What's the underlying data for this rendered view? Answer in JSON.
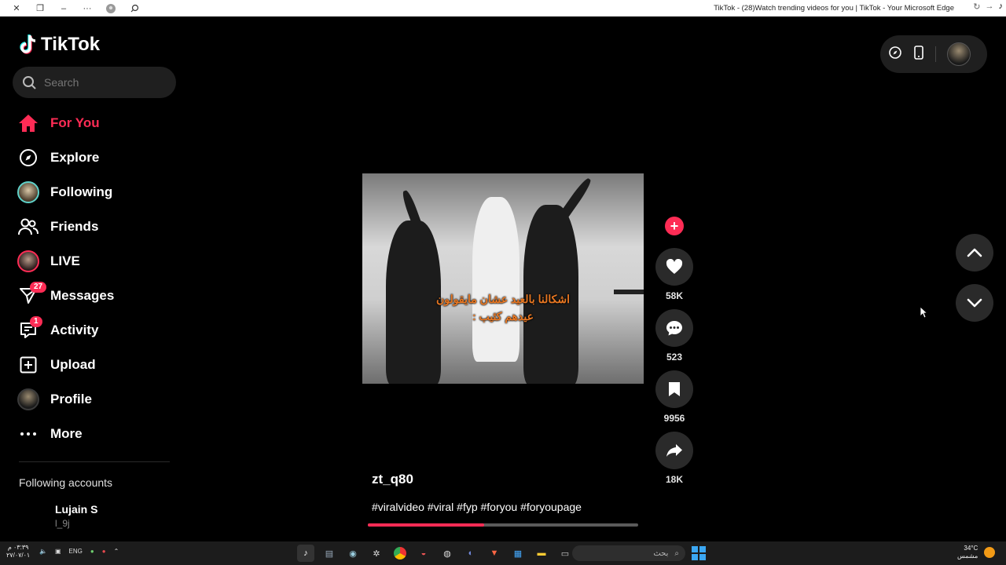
{
  "browser": {
    "title": "TikTok - (28)Watch trending videos for you | TikTok - Your Microsoft Edge"
  },
  "app": {
    "name": "TikTok"
  },
  "search": {
    "placeholder": "Search"
  },
  "sidebar": {
    "items": [
      {
        "label": "For You",
        "icon": "home-icon",
        "active": true
      },
      {
        "label": "Explore",
        "icon": "compass-icon"
      },
      {
        "label": "Following",
        "icon": "avatar"
      },
      {
        "label": "Friends",
        "icon": "friends-icon"
      },
      {
        "label": "LIVE",
        "icon": "avatar"
      },
      {
        "label": "Messages",
        "icon": "send-icon",
        "badge": "27"
      },
      {
        "label": "Activity",
        "icon": "activity-icon",
        "badge": "1"
      },
      {
        "label": "Upload",
        "icon": "plus-square-icon"
      },
      {
        "label": "Profile",
        "icon": "avatar"
      },
      {
        "label": "More",
        "icon": "more-icon"
      }
    ],
    "following_title": "Following accounts",
    "accounts": [
      {
        "name": "Lujain S",
        "handle": "l_9j"
      }
    ]
  },
  "video": {
    "caption_line1": "اشكالنا بالعيد عشان مايقولون",
    "caption_line2": "عيدهم كئيب :",
    "username": "zt_q80",
    "hashtags": "#viralvideo #viral #fyp #foryou #foryoupage",
    "progress": 0.43,
    "likes": "58K",
    "comments": "523",
    "saves": "9956",
    "shares": "18K"
  },
  "taskbar": {
    "time": "٠٣:٣٩ م",
    "date": "٢٧/٠٧/٠١",
    "lang": "ENG",
    "search_placeholder": "بحث",
    "temp": "34°C",
    "weather": "مشمس"
  },
  "colors": {
    "accent": "#fe2c55",
    "background": "#000000",
    "caption": "#e87722"
  }
}
